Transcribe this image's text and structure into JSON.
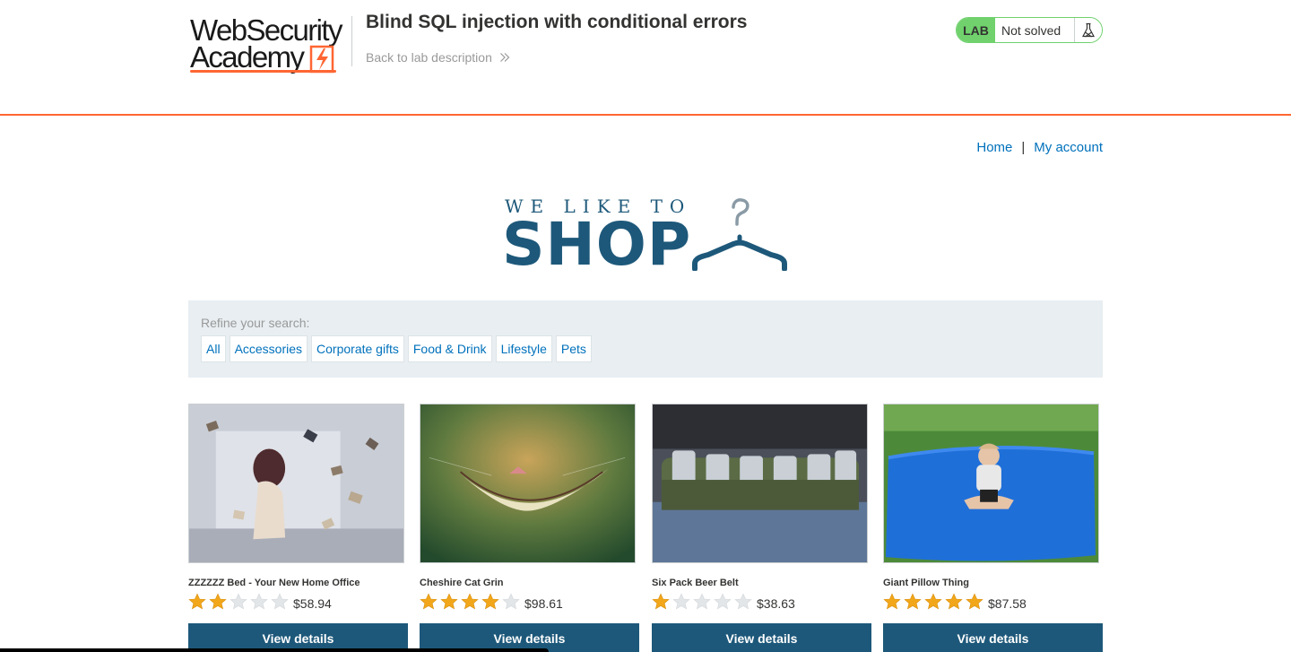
{
  "lab": {
    "logo_text_line1": "WebSecurity",
    "logo_text_line2": "Academy",
    "title": "Blind SQL injection with conditional errors",
    "back_link": "Back to lab description",
    "badge": "LAB",
    "status": "Not solved",
    "accent_color": "#ff6633",
    "solved_color": "#70d16d"
  },
  "nav": {
    "home": "Home",
    "separator": "|",
    "account": "My account"
  },
  "banner": {
    "line1": "WE LIKE TO",
    "line2": "SHOP",
    "icon": "clothes-hanger-icon",
    "color": "#1d587a"
  },
  "filter": {
    "label": "Refine your search:",
    "categories": [
      "All",
      "Accessories",
      "Corporate gifts",
      "Food & Drink",
      "Lifestyle",
      "Pets"
    ]
  },
  "products": [
    {
      "name": "ZZZZZZ Bed - Your New Home Office",
      "rating": 2,
      "max_rating": 5,
      "price": "$58.94",
      "button": "View details"
    },
    {
      "name": "Cheshire Cat Grin",
      "rating": 4,
      "max_rating": 5,
      "price": "$98.61",
      "button": "View details"
    },
    {
      "name": "Six Pack Beer Belt",
      "rating": 1,
      "max_rating": 5,
      "price": "$38.63",
      "button": "View details"
    },
    {
      "name": "Giant Pillow Thing",
      "rating": 5,
      "max_rating": 5,
      "price": "$87.58",
      "button": "View details"
    }
  ]
}
